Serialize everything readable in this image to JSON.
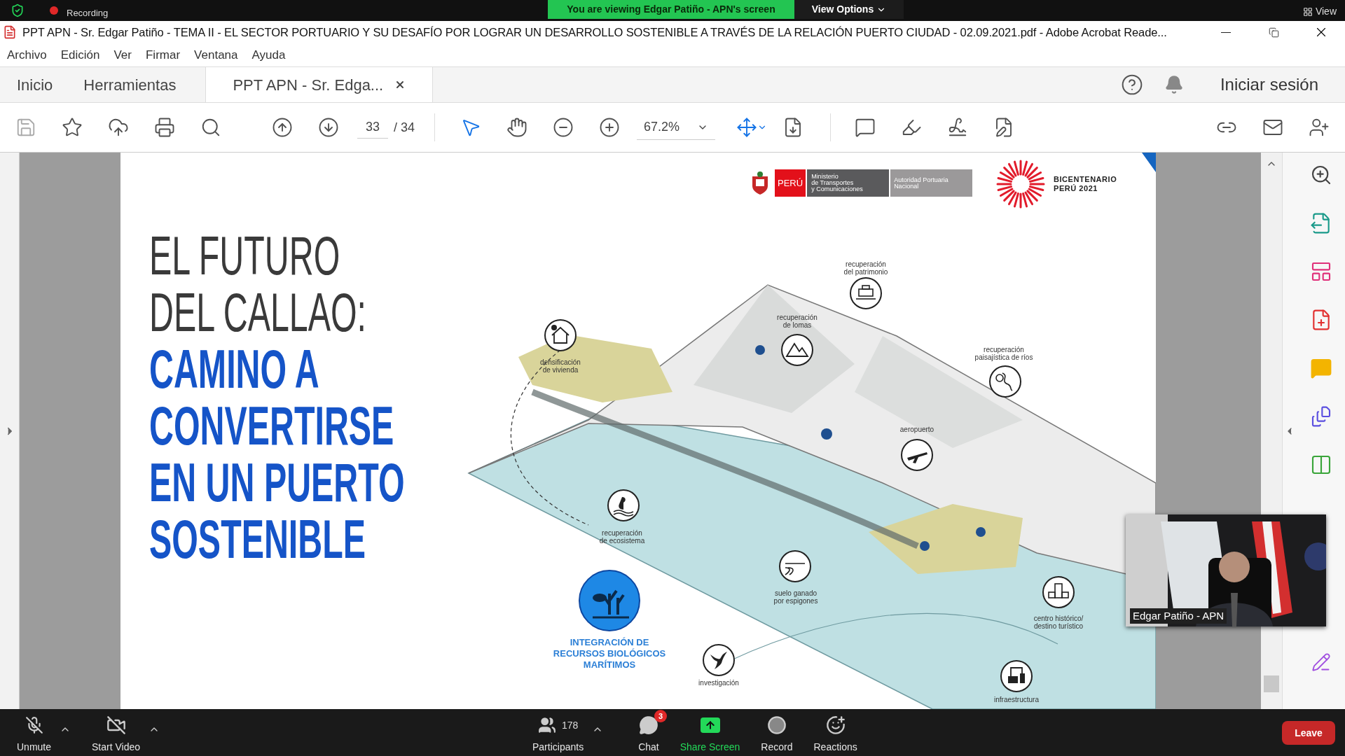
{
  "zoom_top": {
    "recording": "Recording",
    "banner": "You are viewing Edgar Patiño - APN's screen",
    "view_options": "View Options",
    "view": "View"
  },
  "window": {
    "title": "PPT APN - Sr. Edgar Patiño - TEMA II - EL SECTOR PORTUARIO Y SU DESAFÍO POR LOGRAR UN DESARROLLO SOSTENIBLE A TRAVÉS DE LA RELACIÓN PUERTO CIUDAD - 02.09.2021.pdf - Adobe Acrobat Reade..."
  },
  "menu": [
    "Archivo",
    "Edición",
    "Ver",
    "Firmar",
    "Ventana",
    "Ayuda"
  ],
  "tabs": [
    {
      "label": "Inicio",
      "selected": false,
      "kind": "nav"
    },
    {
      "label": "Herramientas",
      "selected": false,
      "kind": "nav"
    },
    {
      "label": "PPT APN - Sr. Edga...",
      "selected": true,
      "kind": "document"
    }
  ],
  "sign_in": "Iniciar sesión",
  "toolbar": {
    "page": "33",
    "page_total": "/ 34",
    "zoom": "67.2%"
  },
  "slide": {
    "logos": {
      "country": "PERÚ",
      "ministry": [
        "Ministerio",
        "de Transportes",
        "y Comunicaciones"
      ],
      "authority": [
        "Autoridad Portuaria",
        "Nacional"
      ],
      "bicentenario": [
        "BICENTENARIO",
        "PERÚ 2021"
      ]
    },
    "title_lines": [
      {
        "text": "EL FUTURO",
        "kind": "light"
      },
      {
        "text": "DEL CALLAO:",
        "kind": "light"
      },
      {
        "text": "CAMINO A",
        "kind": "bold"
      },
      {
        "text": "CONVERTIRSE",
        "kind": "bold"
      },
      {
        "text": "EN UN PUERTO",
        "kind": "bold"
      },
      {
        "text": "SOSTENIBLE",
        "kind": "bold"
      }
    ],
    "map": {
      "markers": [
        {
          "label": [
            "recuperación",
            "del patrimonio"
          ],
          "kind": "heritage"
        },
        {
          "label": [
            "recuperación",
            "de lomas"
          ],
          "kind": "mountain"
        },
        {
          "label": [
            "densificación",
            "de vivienda"
          ],
          "kind": "house"
        },
        {
          "label": [
            "recuperación",
            "paisajística de ríos"
          ],
          "kind": "river"
        },
        {
          "label": [
            "aeropuerto"
          ],
          "kind": "plane"
        },
        {
          "label": [
            "recuperación",
            "de ecosistema"
          ],
          "kind": "bird"
        },
        {
          "label": [
            "suelo ganado",
            "por espigones"
          ],
          "kind": "shore"
        },
        {
          "label": [
            "centro histórico/",
            "destino turístico"
          ],
          "kind": "monument"
        },
        {
          "label": [
            "investigación"
          ],
          "kind": "seabird"
        },
        {
          "label": [
            "infraestructura"
          ],
          "kind": "port"
        }
      ],
      "highlight": [
        "INTEGRACIÓN DE",
        "RECURSOS BIOLÓGICOS",
        "MARÍTIMOS"
      ]
    }
  },
  "video": {
    "name": "Edgar Patiño - APN"
  },
  "meeting_controls": [
    {
      "label": "Unmute",
      "kind": "mic"
    },
    {
      "label": "Start Video",
      "kind": "video"
    },
    {
      "label": "Participants",
      "kind": "participants",
      "count": "178"
    },
    {
      "label": "Chat",
      "kind": "chat",
      "badge": "3"
    },
    {
      "label": "Share Screen",
      "kind": "share"
    },
    {
      "label": "Record",
      "kind": "record"
    },
    {
      "label": "Reactions",
      "kind": "reactions"
    }
  ],
  "leave": "Leave"
}
